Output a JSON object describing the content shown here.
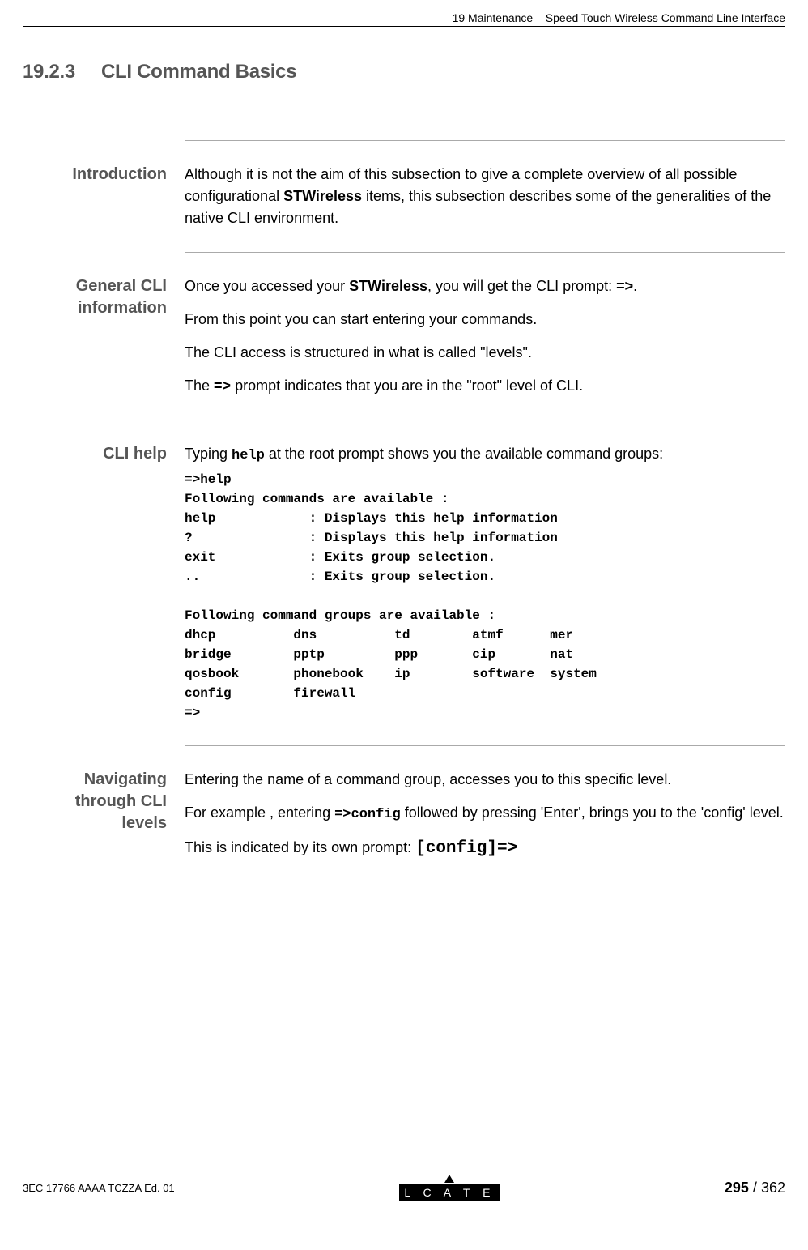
{
  "header": {
    "chapter": "19 Maintenance – Speed Touch Wireless Command Line Interface"
  },
  "title": {
    "number": "19.2.3",
    "text": "CLI Command Basics"
  },
  "sections": {
    "intro": {
      "label": "Introduction",
      "p1a": "Although it is not the aim of this subsection to give a complete overview of all possible configurational ",
      "p1b": "STWireless",
      "p1c": " items, this subsection describes some of the generalities of the native CLI environment."
    },
    "general": {
      "label1": "General CLI",
      "label2": "information",
      "p1a": "Once you accessed your ",
      "p1b": "STWireless",
      "p1c": ", you will get the CLI prompt: ",
      "p1d": "=>",
      "p1e": ".",
      "p2": "From this point you can start entering your commands.",
      "p3": "The CLI access is structured in what is called \"levels\".",
      "p4a": "The ",
      "p4b": "=>",
      "p4c": " prompt indicates that you are in the \"root\" level of CLI."
    },
    "help": {
      "label": "CLI help",
      "p1a": "Typing ",
      "p1b": "help",
      "p1c": " at the root prompt shows you the available command groups:",
      "code": "=>help\nFollowing commands are available :\nhelp            : Displays this help information\n?               : Displays this help information\nexit            : Exits group selection.\n..              : Exits group selection.\n\nFollowing command groups are available :\ndhcp          dns          td        atmf      mer\nbridge        pptp         ppp       cip       nat\nqosbook       phonebook    ip        software  system\nconfig        firewall\n=>"
    },
    "nav": {
      "label1": "Navigating through CLI",
      "label2": "levels",
      "p1": "Entering the name of a command group, accesses you to this specific level.",
      "p2a": "For example , entering ",
      "p2b": "=>config",
      "p2c": " followed by pressing 'Enter', brings you to the 'config' level.",
      "p3a": "This is indicated by its own prompt: ",
      "p3b": "[config]=>"
    }
  },
  "footer": {
    "left": "3EC 17766 AAAA TCZZA Ed. 01",
    "logo_text": "A L C A T E L",
    "page_current": "295",
    "page_sep": " / ",
    "page_total": "362"
  }
}
